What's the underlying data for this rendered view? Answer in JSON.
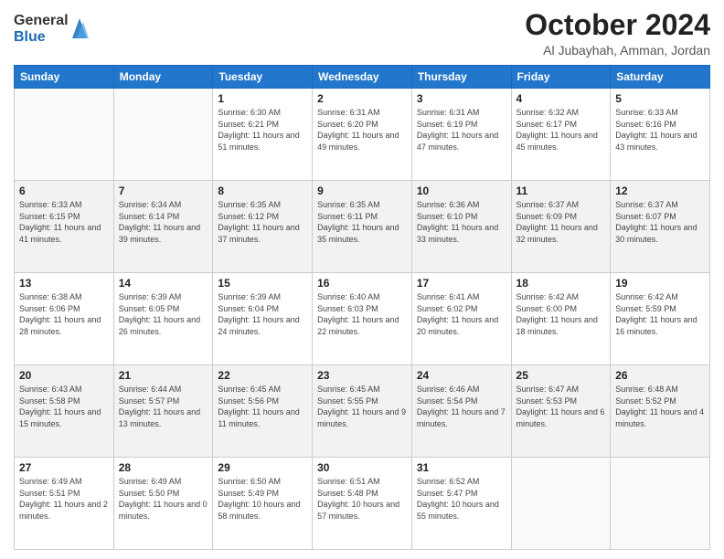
{
  "logo": {
    "general": "General",
    "blue": "Blue"
  },
  "header": {
    "title": "October 2024",
    "subtitle": "Al Jubayhah, Amman, Jordan"
  },
  "weekdays": [
    "Sunday",
    "Monday",
    "Tuesday",
    "Wednesday",
    "Thursday",
    "Friday",
    "Saturday"
  ],
  "weeks": [
    [
      {
        "day": "",
        "info": ""
      },
      {
        "day": "",
        "info": ""
      },
      {
        "day": "1",
        "info": "Sunrise: 6:30 AM\nSunset: 6:21 PM\nDaylight: 11 hours and 51 minutes."
      },
      {
        "day": "2",
        "info": "Sunrise: 6:31 AM\nSunset: 6:20 PM\nDaylight: 11 hours and 49 minutes."
      },
      {
        "day": "3",
        "info": "Sunrise: 6:31 AM\nSunset: 6:19 PM\nDaylight: 11 hours and 47 minutes."
      },
      {
        "day": "4",
        "info": "Sunrise: 6:32 AM\nSunset: 6:17 PM\nDaylight: 11 hours and 45 minutes."
      },
      {
        "day": "5",
        "info": "Sunrise: 6:33 AM\nSunset: 6:16 PM\nDaylight: 11 hours and 43 minutes."
      }
    ],
    [
      {
        "day": "6",
        "info": "Sunrise: 6:33 AM\nSunset: 6:15 PM\nDaylight: 11 hours and 41 minutes."
      },
      {
        "day": "7",
        "info": "Sunrise: 6:34 AM\nSunset: 6:14 PM\nDaylight: 11 hours and 39 minutes."
      },
      {
        "day": "8",
        "info": "Sunrise: 6:35 AM\nSunset: 6:12 PM\nDaylight: 11 hours and 37 minutes."
      },
      {
        "day": "9",
        "info": "Sunrise: 6:35 AM\nSunset: 6:11 PM\nDaylight: 11 hours and 35 minutes."
      },
      {
        "day": "10",
        "info": "Sunrise: 6:36 AM\nSunset: 6:10 PM\nDaylight: 11 hours and 33 minutes."
      },
      {
        "day": "11",
        "info": "Sunrise: 6:37 AM\nSunset: 6:09 PM\nDaylight: 11 hours and 32 minutes."
      },
      {
        "day": "12",
        "info": "Sunrise: 6:37 AM\nSunset: 6:07 PM\nDaylight: 11 hours and 30 minutes."
      }
    ],
    [
      {
        "day": "13",
        "info": "Sunrise: 6:38 AM\nSunset: 6:06 PM\nDaylight: 11 hours and 28 minutes."
      },
      {
        "day": "14",
        "info": "Sunrise: 6:39 AM\nSunset: 6:05 PM\nDaylight: 11 hours and 26 minutes."
      },
      {
        "day": "15",
        "info": "Sunrise: 6:39 AM\nSunset: 6:04 PM\nDaylight: 11 hours and 24 minutes."
      },
      {
        "day": "16",
        "info": "Sunrise: 6:40 AM\nSunset: 6:03 PM\nDaylight: 11 hours and 22 minutes."
      },
      {
        "day": "17",
        "info": "Sunrise: 6:41 AM\nSunset: 6:02 PM\nDaylight: 11 hours and 20 minutes."
      },
      {
        "day": "18",
        "info": "Sunrise: 6:42 AM\nSunset: 6:00 PM\nDaylight: 11 hours and 18 minutes."
      },
      {
        "day": "19",
        "info": "Sunrise: 6:42 AM\nSunset: 5:59 PM\nDaylight: 11 hours and 16 minutes."
      }
    ],
    [
      {
        "day": "20",
        "info": "Sunrise: 6:43 AM\nSunset: 5:58 PM\nDaylight: 11 hours and 15 minutes."
      },
      {
        "day": "21",
        "info": "Sunrise: 6:44 AM\nSunset: 5:57 PM\nDaylight: 11 hours and 13 minutes."
      },
      {
        "day": "22",
        "info": "Sunrise: 6:45 AM\nSunset: 5:56 PM\nDaylight: 11 hours and 11 minutes."
      },
      {
        "day": "23",
        "info": "Sunrise: 6:45 AM\nSunset: 5:55 PM\nDaylight: 11 hours and 9 minutes."
      },
      {
        "day": "24",
        "info": "Sunrise: 6:46 AM\nSunset: 5:54 PM\nDaylight: 11 hours and 7 minutes."
      },
      {
        "day": "25",
        "info": "Sunrise: 6:47 AM\nSunset: 5:53 PM\nDaylight: 11 hours and 6 minutes."
      },
      {
        "day": "26",
        "info": "Sunrise: 6:48 AM\nSunset: 5:52 PM\nDaylight: 11 hours and 4 minutes."
      }
    ],
    [
      {
        "day": "27",
        "info": "Sunrise: 6:49 AM\nSunset: 5:51 PM\nDaylight: 11 hours and 2 minutes."
      },
      {
        "day": "28",
        "info": "Sunrise: 6:49 AM\nSunset: 5:50 PM\nDaylight: 11 hours and 0 minutes."
      },
      {
        "day": "29",
        "info": "Sunrise: 6:50 AM\nSunset: 5:49 PM\nDaylight: 10 hours and 58 minutes."
      },
      {
        "day": "30",
        "info": "Sunrise: 6:51 AM\nSunset: 5:48 PM\nDaylight: 10 hours and 57 minutes."
      },
      {
        "day": "31",
        "info": "Sunrise: 6:52 AM\nSunset: 5:47 PM\nDaylight: 10 hours and 55 minutes."
      },
      {
        "day": "",
        "info": ""
      },
      {
        "day": "",
        "info": ""
      }
    ]
  ]
}
